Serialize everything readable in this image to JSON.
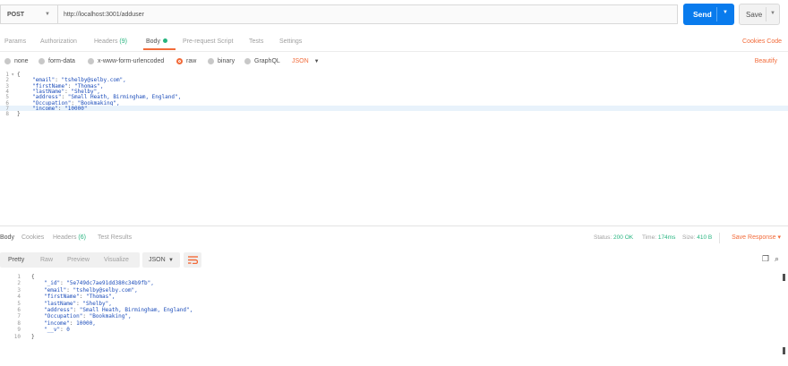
{
  "request": {
    "method": "POST",
    "url": "http://localhost:3001/adduser",
    "send_label": "Send",
    "save_label": "Save"
  },
  "request_tabs": [
    {
      "label": "Params"
    },
    {
      "label": "Authorization"
    },
    {
      "label": "Headers",
      "count": "(9)"
    },
    {
      "label": "Body",
      "active": true,
      "has_dot": true
    },
    {
      "label": "Pre-request Script"
    },
    {
      "label": "Tests"
    },
    {
      "label": "Settings"
    }
  ],
  "right_links": "Cookies  Code",
  "body_types": {
    "options": [
      "none",
      "form-data",
      "x-www-form-urlencoded",
      "raw",
      "binary",
      "GraphQL"
    ],
    "selected": "raw",
    "language": "JSON",
    "beautify": "Beautify"
  },
  "request_body": [
    {
      "n": "1",
      "text": "{",
      "fold": "▾"
    },
    {
      "n": "2",
      "key": "\"email\"",
      "val": "\"tshelby@selby.com\","
    },
    {
      "n": "3",
      "key": "\"firstName\"",
      "val": "\"Thomas\","
    },
    {
      "n": "4",
      "key": "\"lastName\"",
      "val": "\"Shelby\","
    },
    {
      "n": "5",
      "key": "\"address\"",
      "val": "\"Small Heath, Birmingham, England\","
    },
    {
      "n": "6",
      "key": "\"Occupation\"",
      "val": "\"Bookmaking\","
    },
    {
      "n": "7",
      "key": "\"income\"",
      "val": "\"10000\"",
      "highlight": true
    },
    {
      "n": "8",
      "text": "}"
    }
  ],
  "response_tabs": [
    {
      "label": "Body",
      "active": true
    },
    {
      "label": "Cookies"
    },
    {
      "label": "Headers",
      "count": "(6)"
    },
    {
      "label": "Test Results"
    }
  ],
  "response_status": {
    "status_label": "Status:",
    "status": "200 OK",
    "time_label": "Time:",
    "time": "174ms",
    "size_label": "Size:",
    "size": "410 B",
    "save_response": "Save Response"
  },
  "response_view": {
    "modes": [
      "Pretty",
      "Raw",
      "Preview",
      "Visualize"
    ],
    "active_mode": "Pretty",
    "format": "JSON"
  },
  "response_body": [
    {
      "n": "1",
      "text": "{"
    },
    {
      "n": "2",
      "key": "\"_id\"",
      "val": "\"5e749dc7ae91dd380c34b9fb\","
    },
    {
      "n": "3",
      "key": "\"email\"",
      "val": "\"tshelby@selby.com\","
    },
    {
      "n": "4",
      "key": "\"firstName\"",
      "val": "\"Thomas\","
    },
    {
      "n": "5",
      "key": "\"lastName\"",
      "val": "\"Shelby\","
    },
    {
      "n": "6",
      "key": "\"address\"",
      "val": "\"Small Heath, Birmingham, England\","
    },
    {
      "n": "7",
      "key": "\"Occupation\"",
      "val": "\"Bookmaking\","
    },
    {
      "n": "8",
      "key": "\"income\"",
      "val": "10000,"
    },
    {
      "n": "9",
      "key": "\"__v\"",
      "val": "0"
    },
    {
      "n": "10",
      "text": "}"
    }
  ],
  "colors": {
    "accent": "#f26b3a",
    "send": "#097bed",
    "success": "#26b47f",
    "code_string": "#1b4cba"
  }
}
